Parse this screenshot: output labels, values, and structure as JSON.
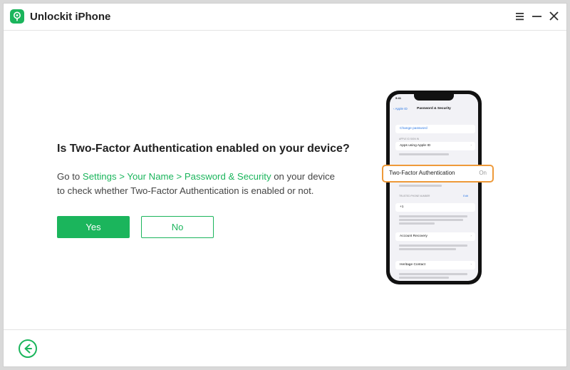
{
  "app": {
    "title": "Unlockit iPhone"
  },
  "window_controls": {
    "menu_icon": "menu-icon",
    "minimize_icon": "minimize-icon",
    "close_icon": "close-icon"
  },
  "main": {
    "question": "Is Two-Factor Authentication enabled on your device?",
    "instructions": {
      "prefix": "Go to ",
      "path": "Settings > Your Name > Password & Security",
      "suffix": " on your device to check whether Two-Factor Authentication is enabled or not."
    },
    "yes_label": "Yes",
    "no_label": "No"
  },
  "phone": {
    "time": "9:41",
    "back_label": "Apple ID",
    "title": "Password & Security",
    "change_password": "Change password",
    "section_apple_id": "APPLE ID SIGN IN",
    "apps_using_apple_id": "Apps using Apple ID",
    "trusted_numbers": "TRUSTED PHONE NUMBER",
    "edit_label": "Edit",
    "phone_number": "+1",
    "account_recovery": "Account Recovery",
    "heritage_contact": "Heritage Contact",
    "tfa_label": "Two-Factor Authentication",
    "tfa_value": "On"
  },
  "footer": {
    "back_icon": "back-arrow-icon"
  },
  "colors": {
    "accent": "#1bb55c",
    "highlight": "#ee9a3a",
    "ios_link": "#2f7ae5"
  }
}
